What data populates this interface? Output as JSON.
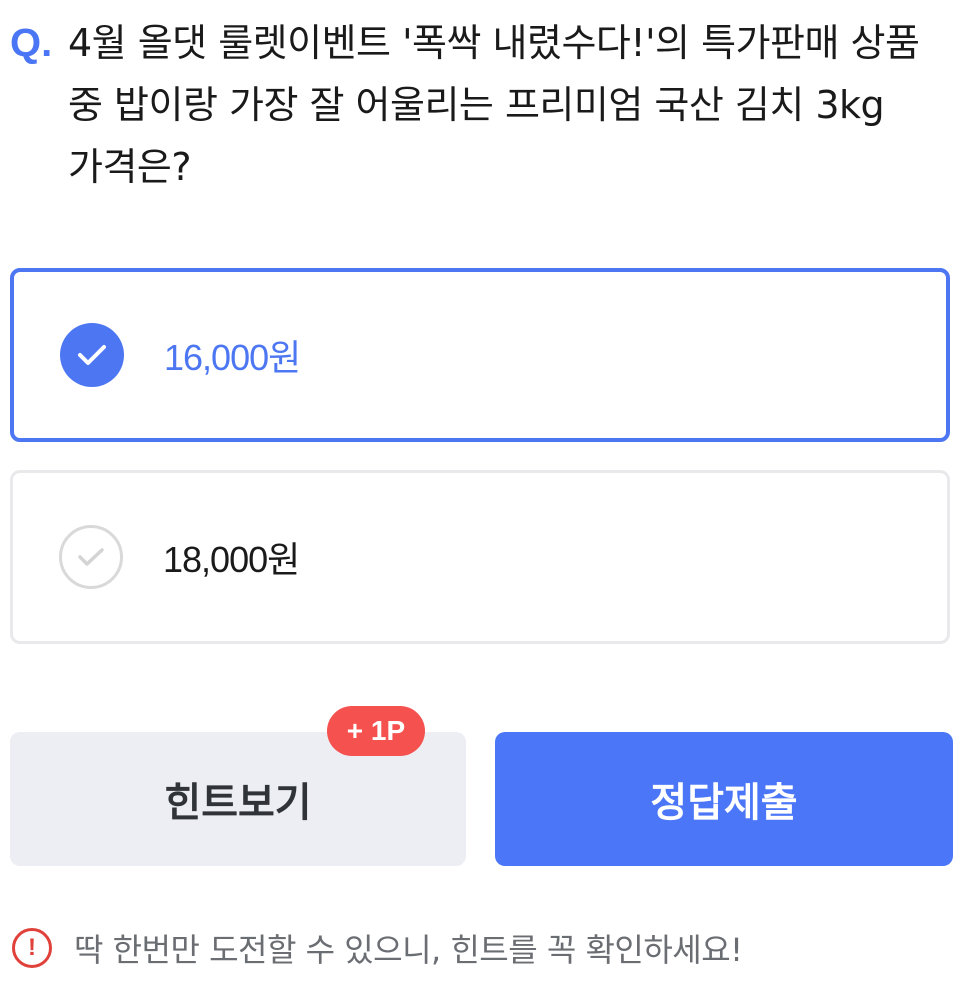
{
  "question": {
    "prefix": "Q.",
    "text": "4월 올댓 룰렛이벤트 '폭싹 내렸수다!'의 특가판매 상품 중 밥이랑 가장 잘 어울리는 프리미엄 국산 김치 3kg 가격은?"
  },
  "options": [
    {
      "label": "16,000원",
      "selected": true
    },
    {
      "label": "18,000원",
      "selected": false
    }
  ],
  "hint_button": {
    "label": "힌트보기",
    "badge": "+ 1P"
  },
  "submit_button": {
    "label": "정답제출"
  },
  "notice": {
    "icon": "exclamation-circle-icon",
    "text": "딱 한번만 도전할 수 있으니, 힌트를 꼭 확인하세요!"
  },
  "colors": {
    "accent": "#4d77f2",
    "badge": "#f4514f",
    "warning": "#e0423b",
    "hint_bg": "#eceef3"
  }
}
